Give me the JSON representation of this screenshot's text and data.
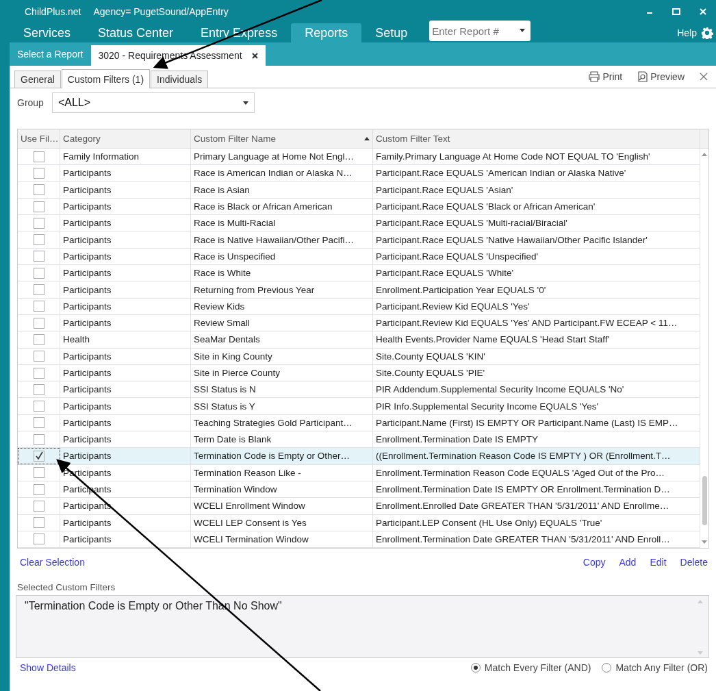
{
  "title_bar": {
    "app": "ChildPlus.net",
    "agency": "Agency= PugetSound/AppEntry"
  },
  "nav": {
    "items": [
      {
        "label": "Services",
        "selected": false
      },
      {
        "label": "Status Center",
        "selected": false
      },
      {
        "label": "Entry Express",
        "selected": false
      },
      {
        "label": "Reports",
        "selected": true
      },
      {
        "label": "Setup",
        "selected": false
      }
    ],
    "report_field": {
      "placeholder": "Enter Report #"
    },
    "help": "Help"
  },
  "doc_tabs": [
    {
      "label": "Select a Report",
      "selected": false
    },
    {
      "label": "3020 - Requirements Assessment",
      "selected": true
    }
  ],
  "sub_tabs": [
    {
      "label": "General",
      "selected": false
    },
    {
      "label": "Custom Filters (1)",
      "selected": true
    },
    {
      "label": "Individuals",
      "selected": false
    }
  ],
  "toolbar": {
    "print": "Print",
    "preview": "Preview"
  },
  "group": {
    "label": "Group",
    "value": "<ALL>"
  },
  "table": {
    "columns": [
      "Use Fil…",
      "Category",
      "Custom Filter Name",
      "Custom Filter Text"
    ],
    "rows": [
      {
        "checked": false,
        "selected": false,
        "category": "Family Information",
        "name": "Primary Language at Home Not Engl…",
        "text": "Family.Primary Language At Home Code NOT EQUAL TO 'English'"
      },
      {
        "checked": false,
        "selected": false,
        "category": "Participants",
        "name": "Race is American Indian or Alaska N…",
        "text": "Participant.Race EQUALS 'American Indian or Alaska Native'"
      },
      {
        "checked": false,
        "selected": false,
        "category": "Participants",
        "name": "Race is Asian",
        "text": "Participant.Race EQUALS 'Asian'"
      },
      {
        "checked": false,
        "selected": false,
        "category": "Participants",
        "name": "Race is Black or African American",
        "text": "Participant.Race EQUALS 'Black or African American'"
      },
      {
        "checked": false,
        "selected": false,
        "category": "Participants",
        "name": "Race is Multi-Racial",
        "text": "Participant.Race EQUALS 'Multi-racial/Biracial'"
      },
      {
        "checked": false,
        "selected": false,
        "category": "Participants",
        "name": "Race is Native Hawaiian/Other Pacifi…",
        "text": "Participant.Race EQUALS 'Native Hawaiian/Other Pacific Islander'"
      },
      {
        "checked": false,
        "selected": false,
        "category": "Participants",
        "name": "Race is Unspecified",
        "text": "Participant.Race EQUALS 'Unspecified'"
      },
      {
        "checked": false,
        "selected": false,
        "category": "Participants",
        "name": "Race is White",
        "text": "Participant.Race EQUALS 'White'"
      },
      {
        "checked": false,
        "selected": false,
        "category": "Participants",
        "name": "Returning from Previous Year",
        "text": "Enrollment.Participation Year EQUALS '0'"
      },
      {
        "checked": false,
        "selected": false,
        "category": "Participants",
        "name": "Review Kids",
        "text": "Participant.Review Kid EQUALS 'Yes'"
      },
      {
        "checked": false,
        "selected": false,
        "category": "Participants",
        "name": "Review Small",
        "text": "Participant.Review Kid EQUALS 'Yes' AND Participant.FW ECEAP < 11…"
      },
      {
        "checked": false,
        "selected": false,
        "category": "Health",
        "name": "SeaMar Dentals",
        "text": "Health Events.Provider Name EQUALS 'Head Start Staff'"
      },
      {
        "checked": false,
        "selected": false,
        "category": "Participants",
        "name": "Site in King County",
        "text": "Site.County EQUALS 'KIN'"
      },
      {
        "checked": false,
        "selected": false,
        "category": "Participants",
        "name": "Site in Pierce County",
        "text": "Site.County EQUALS 'PIE'"
      },
      {
        "checked": false,
        "selected": false,
        "category": "Participants",
        "name": "SSI Status is N",
        "text": "PIR Addendum.Supplemental Security Income EQUALS 'No'"
      },
      {
        "checked": false,
        "selected": false,
        "category": "Participants",
        "name": "SSI Status is Y",
        "text": "PIR Info.Supplemental Security Income EQUALS 'Yes'"
      },
      {
        "checked": false,
        "selected": false,
        "category": "Participants",
        "name": "Teaching Strategies Gold Participant…",
        "text": "Participant.Name (First) IS EMPTY OR Participant.Name (Last) IS EMP…"
      },
      {
        "checked": false,
        "selected": false,
        "category": "Participants",
        "name": "Term Date is Blank",
        "text": "Enrollment.Termination Date IS EMPTY"
      },
      {
        "checked": true,
        "selected": true,
        "category": "Participants",
        "name": "Termination Code is Empty or Other…",
        "text": "((Enrollment.Termination Reason Code IS EMPTY ) OR (Enrollment.T…"
      },
      {
        "checked": false,
        "selected": false,
        "category": "Participants",
        "name": "Termination Reason Like -",
        "text": "Enrollment.Termination Reason Code EQUALS 'Aged Out of the Pro…"
      },
      {
        "checked": false,
        "selected": false,
        "category": "Participants",
        "name": "Termination Window",
        "text": "Enrollment.Termination Date IS EMPTY OR Enrollment.Termination D…"
      },
      {
        "checked": false,
        "selected": false,
        "category": "Participants",
        "name": "WCELI Enrollment Window",
        "text": "Enrollment.Enrolled Date GREATER THAN '5/31/2011' AND Enrollme…"
      },
      {
        "checked": false,
        "selected": false,
        "category": "Participants",
        "name": "WCELI LEP Consent is Yes",
        "text": "Participant.LEP Consent (HL Use Only) EQUALS 'True'"
      },
      {
        "checked": false,
        "selected": false,
        "category": "Participants",
        "name": "WCELI Termination Window",
        "text": "Enrollment.Termination Date GREATER THAN '5/31/2011' AND Enroll…"
      }
    ]
  },
  "actions": {
    "clear": "Clear Selection",
    "buttons": [
      "Copy",
      "Add",
      "Edit",
      "Delete"
    ]
  },
  "selected_filters": {
    "label": "Selected Custom Filters",
    "text": "\"Termination Code is Empty or Other Than No Show\""
  },
  "show_details": "Show Details",
  "match_options": [
    {
      "label": "Match Every Filter (AND)",
      "selected": true
    },
    {
      "label": "Match Any Filter (OR)",
      "selected": false
    }
  ]
}
